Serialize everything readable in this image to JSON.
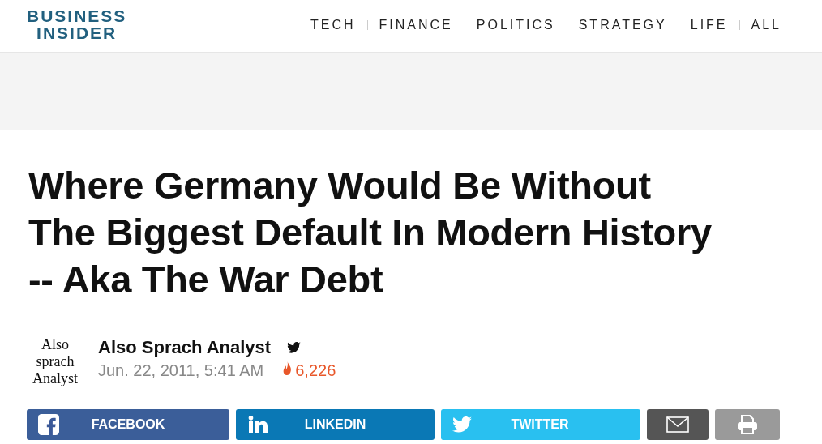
{
  "logo": {
    "lines": [
      "BUSINESS",
      "INSIDER"
    ]
  },
  "nav": [
    "TECH",
    "FINANCE",
    "POLITICS",
    "STRATEGY",
    "LIFE",
    "ALL"
  ],
  "headline": "Where Germany Would Be Without The Biggest Default In Modern History -- Aka The War Debt",
  "byline": {
    "avatar_text": [
      "Also",
      "sprach",
      "Analyst"
    ],
    "author": "Also Sprach Analyst",
    "date": "Jun. 22, 2011, 5:41 AM",
    "views": "6,226"
  },
  "share": [
    {
      "kind": "facebook",
      "label": "FACEBOOK"
    },
    {
      "kind": "linkedin",
      "label": "LINKEDIN"
    },
    {
      "kind": "twitter",
      "label": "TWITTER"
    },
    {
      "kind": "email"
    },
    {
      "kind": "print"
    }
  ]
}
